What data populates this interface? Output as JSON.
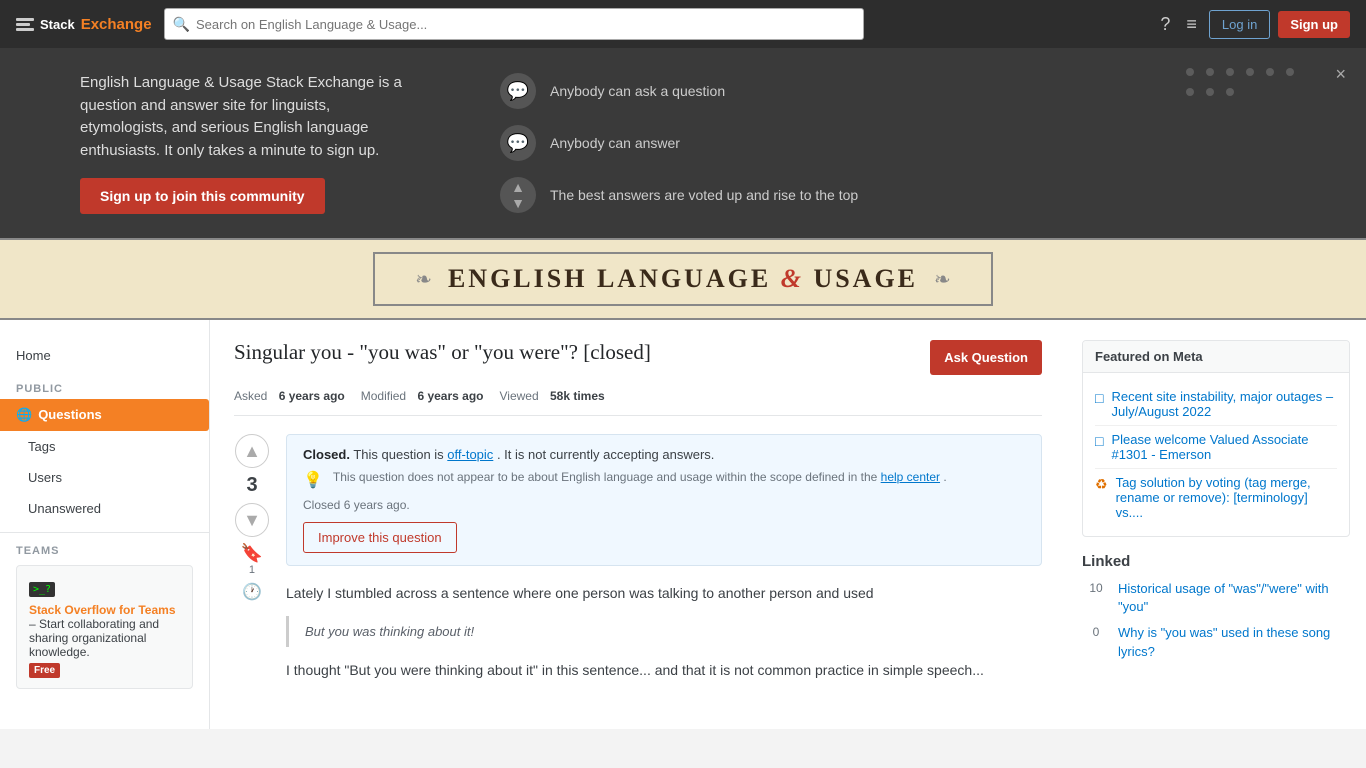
{
  "site": {
    "name": "Stack Exchange",
    "stack": "Stack",
    "exchange": "Exchange"
  },
  "nav": {
    "search_placeholder": "Search on English Language & Usage...",
    "login_label": "Log in",
    "signup_label": "Sign up"
  },
  "hero": {
    "description": "English Language & Usage Stack Exchange is a question and answer site for linguists, etymologists, and serious English language enthusiasts. It only takes a minute to sign up.",
    "join_label": "Sign up to join this community",
    "features": [
      {
        "icon": "💬",
        "text": "Anybody can ask a question"
      },
      {
        "icon": "💬",
        "text": "Anybody can answer"
      },
      {
        "icon": "▲▼",
        "text": "The best answers are voted up and rise to the top"
      }
    ],
    "close_label": "×"
  },
  "site_header": {
    "deco_left": "❧",
    "title_part1": "ENGLISH LANGUAGE",
    "amp": "&",
    "title_part2": "USAGE",
    "deco_right": "❧"
  },
  "sidebar": {
    "home_label": "Home",
    "public_label": "PUBLIC",
    "questions_label": "Questions",
    "tags_label": "Tags",
    "users_label": "Users",
    "unanswered_label": "Unanswered",
    "teams_label": "TEAMS",
    "teams_card": {
      "title": "Stack Overflow for Teams",
      "description": " – Start collaborating and sharing organizational knowledge.",
      "free_label": "Free"
    }
  },
  "question": {
    "title": "Singular you - \"you was\" or \"you were\"? [closed]",
    "asked_label": "Asked",
    "asked_time": "6 years ago",
    "modified_label": "Modified",
    "modified_time": "6 years ago",
    "viewed_label": "Viewed",
    "viewed_count": "58k times",
    "vote_count": "3",
    "bookmark_count": "1",
    "ask_button": "Ask Question",
    "closed_notice": {
      "header_bold": "Closed.",
      "header_text": " This question is ",
      "off_topic": "off-topic",
      "header_end": ". It is not currently accepting answers.",
      "body_text": "This question does not appear to be about English language and usage within the scope defined in the ",
      "help_center": "help center",
      "body_end": ".",
      "closed_time": "Closed 6 years ago."
    },
    "improve_label": "Improve this question",
    "body_text": "Lately I stumbled across a sentence where one person was talking to another person and used",
    "blockquote": "But you was thinking about it!",
    "body_text2": "I thought \"But you were thinking about it\" in this sentence... and that it is not common practice in simple speech..."
  },
  "meta": {
    "title": "Featured on Meta",
    "items": [
      {
        "icon": "□",
        "type": "post",
        "text": "Recent site instability, major outages – July/August 2022"
      },
      {
        "icon": "□",
        "type": "post",
        "text": "Please welcome Valued Associate #1301 - Emerson"
      },
      {
        "icon": "♻",
        "type": "tag",
        "text": "Tag solution by voting (tag merge, rename or remove): [terminology] vs...."
      }
    ]
  },
  "linked": {
    "title": "Linked",
    "items": [
      {
        "count": "10",
        "text": "Historical usage of \"was\"/\"were\" with \"you\""
      },
      {
        "count": "0",
        "text": "Why is \"you was\" used in these song lyrics?"
      }
    ]
  }
}
